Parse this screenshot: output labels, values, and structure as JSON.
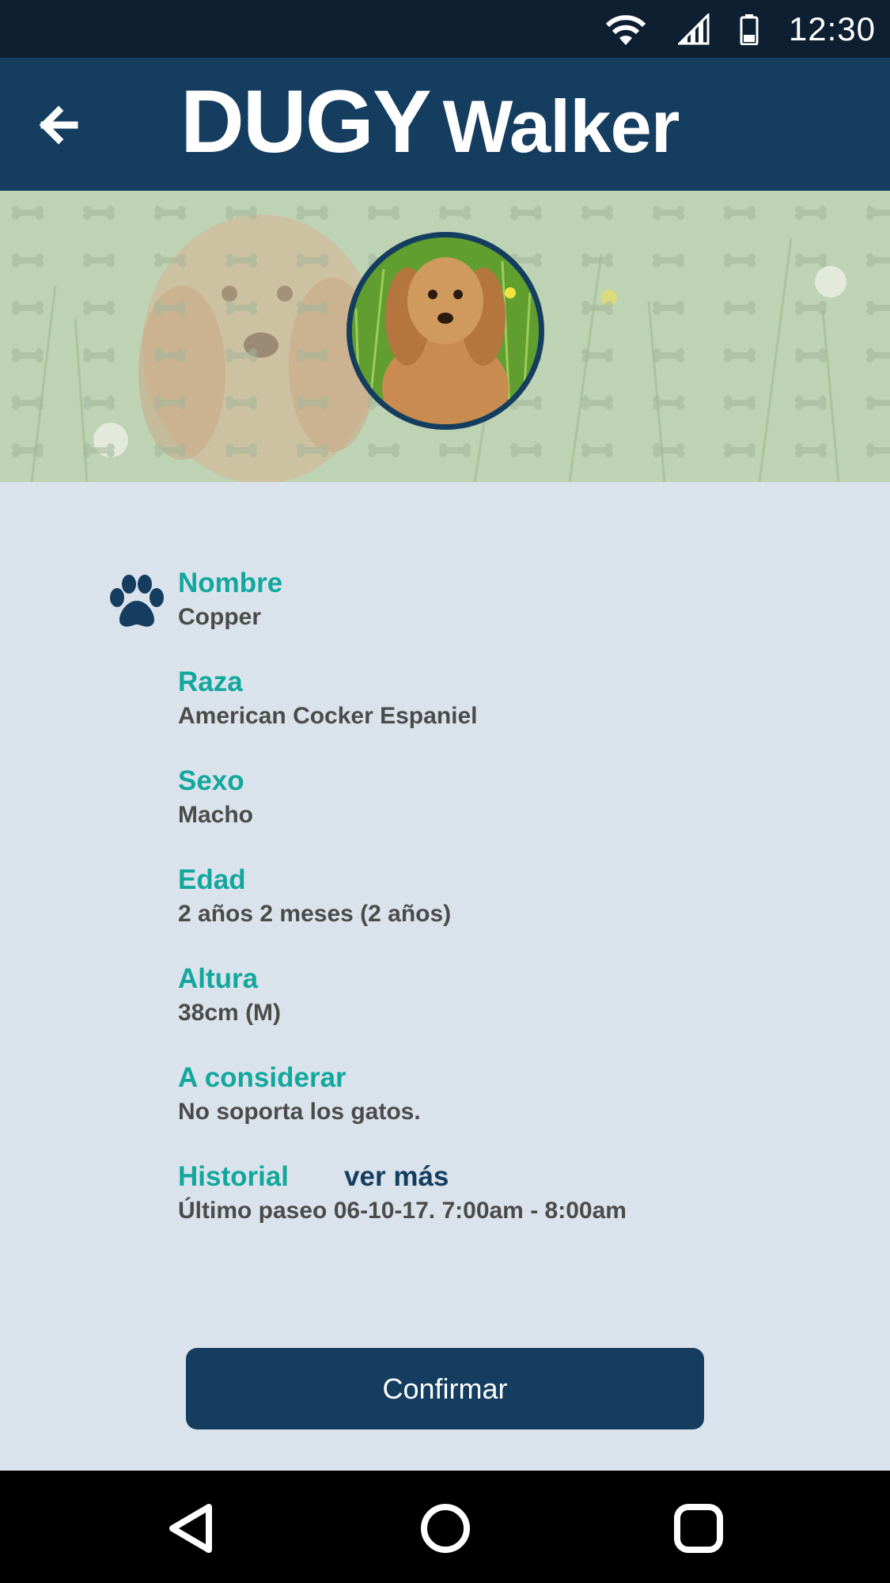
{
  "status_bar": {
    "time": "12:30",
    "icons": [
      "wifi-icon",
      "signal-icon",
      "battery-icon"
    ]
  },
  "app_bar": {
    "logo_word1": "DUGY",
    "logo_word2": "Walker",
    "back_icon": "arrow-left-icon"
  },
  "colors": {
    "primary": "#143d60",
    "accent": "#12a79d",
    "background": "#dae3eb",
    "text": "#4b4b4b"
  },
  "pet": {
    "icon": "paw-icon",
    "fields": [
      {
        "label": "Nombre",
        "value": "Copper"
      },
      {
        "label": "Raza",
        "value": "American Cocker Espaniel"
      },
      {
        "label": "Sexo",
        "value": "Macho"
      },
      {
        "label": "Edad",
        "value": "2 años 2 meses (2 años)"
      },
      {
        "label": "Altura",
        "value": "38cm (M)"
      },
      {
        "label": "A considerar",
        "value": "No soporta los gatos."
      },
      {
        "label": "Historial",
        "link": "ver más",
        "value": "Último paseo 06-10-17. 7:00am - 8:00am"
      }
    ]
  },
  "actions": {
    "confirm_label": "Confirmar"
  },
  "nav_bar": {
    "buttons": [
      "back-triangle-icon",
      "home-circle-icon",
      "recents-square-icon"
    ]
  }
}
